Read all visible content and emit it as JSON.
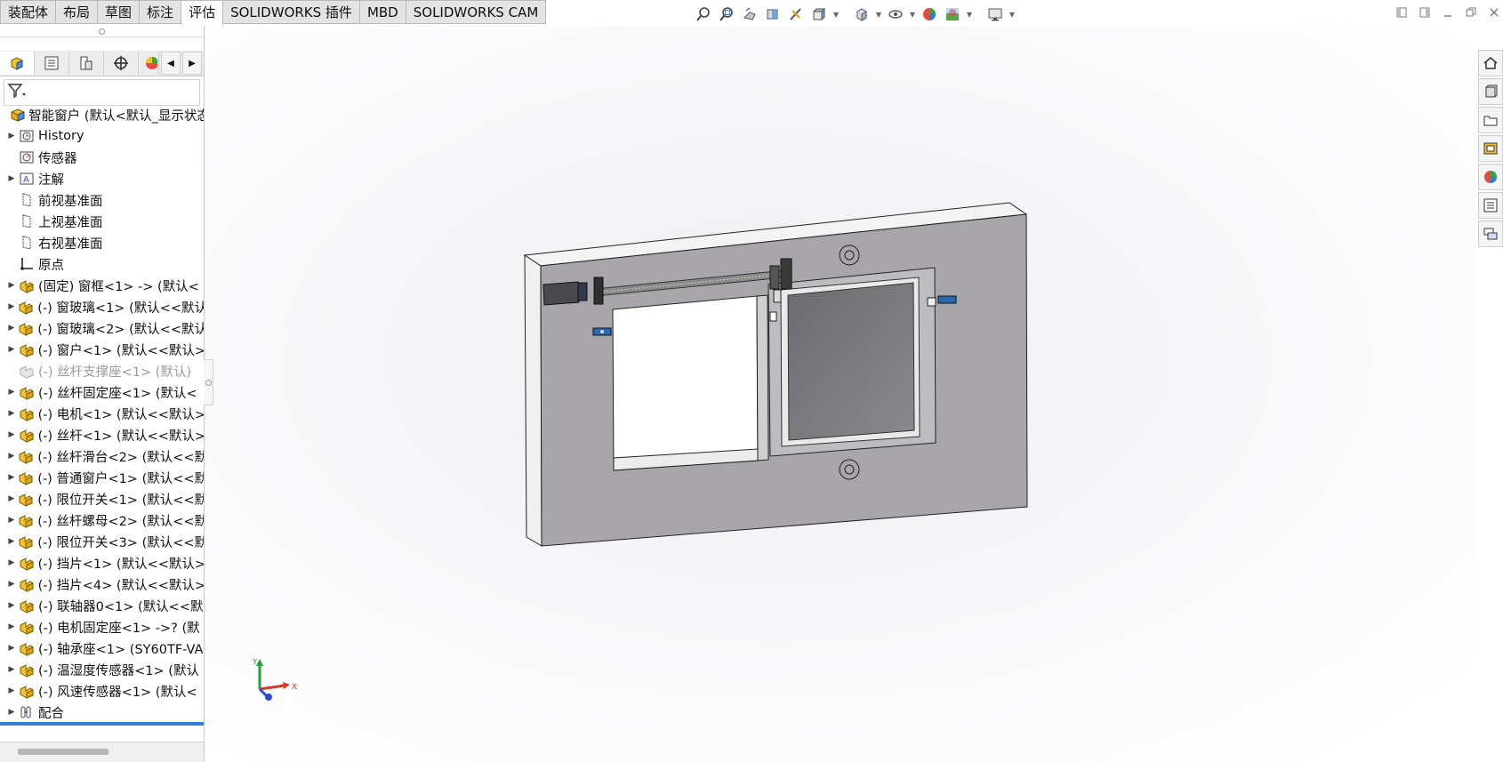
{
  "tabs": [
    {
      "label": "装配体",
      "active": false
    },
    {
      "label": "布局",
      "active": false
    },
    {
      "label": "草图",
      "active": false
    },
    {
      "label": "标注",
      "active": false
    },
    {
      "label": "评估",
      "active": true
    },
    {
      "label": "SOLIDWORKS 插件",
      "active": false
    },
    {
      "label": "MBD",
      "active": false
    },
    {
      "label": "SOLIDWORKS CAM",
      "active": false
    }
  ],
  "tree": {
    "root": "智能窗户 (默认<默认_显示状态",
    "items": [
      {
        "label": "History",
        "icon": "history-icon",
        "expand": true,
        "dim": false
      },
      {
        "label": "传感器",
        "icon": "sensor-icon",
        "expand": false,
        "dim": false
      },
      {
        "label": "注解",
        "icon": "annotation-icon",
        "expand": true,
        "dim": false
      },
      {
        "label": "前视基准面",
        "icon": "plane-icon",
        "expand": false,
        "dim": false
      },
      {
        "label": "上视基准面",
        "icon": "plane-icon",
        "expand": false,
        "dim": false
      },
      {
        "label": "右视基准面",
        "icon": "plane-icon",
        "expand": false,
        "dim": false
      },
      {
        "label": "原点",
        "icon": "origin-icon",
        "expand": false,
        "dim": false
      },
      {
        "label": "(固定) 窗框<1> -> (默认<",
        "icon": "part-icon",
        "expand": true,
        "dim": false
      },
      {
        "label": "(-) 窗玻璃<1> (默认<<默认",
        "icon": "part-icon",
        "expand": true,
        "dim": false
      },
      {
        "label": "(-) 窗玻璃<2> (默认<<默认",
        "icon": "part-icon",
        "expand": true,
        "dim": false
      },
      {
        "label": "(-) 窗户<1> (默认<<默认>",
        "icon": "part-icon",
        "expand": true,
        "dim": false
      },
      {
        "label": "(-) 丝杆支撑座<1> (默认)",
        "icon": "part-icon",
        "expand": false,
        "dim": true
      },
      {
        "label": "(-) 丝杆固定座<1> (默认<",
        "icon": "part-icon",
        "expand": true,
        "dim": false
      },
      {
        "label": "(-) 电机<1> (默认<<默认>",
        "icon": "part-icon",
        "expand": true,
        "dim": false
      },
      {
        "label": "(-) 丝杆<1> (默认<<默认>",
        "icon": "part-icon",
        "expand": true,
        "dim": false
      },
      {
        "label": "(-) 丝杆滑台<2> (默认<<默",
        "icon": "part-icon",
        "expand": true,
        "dim": false
      },
      {
        "label": "(-) 普通窗户<1> (默认<<默",
        "icon": "part-icon",
        "expand": true,
        "dim": false
      },
      {
        "label": "(-) 限位开关<1> (默认<<默",
        "icon": "part-icon",
        "expand": true,
        "dim": false
      },
      {
        "label": "(-) 丝杆螺母<2> (默认<<默",
        "icon": "part-icon",
        "expand": true,
        "dim": false
      },
      {
        "label": "(-) 限位开关<3> (默认<<默",
        "icon": "part-icon",
        "expand": true,
        "dim": false
      },
      {
        "label": "(-) 挡片<1> (默认<<默认>",
        "icon": "part-icon",
        "expand": true,
        "dim": false
      },
      {
        "label": "(-) 挡片<4> (默认<<默认>",
        "icon": "part-icon",
        "expand": true,
        "dim": false
      },
      {
        "label": "(-) 联轴器0<1> (默认<<默",
        "icon": "part-icon",
        "expand": true,
        "dim": false
      },
      {
        "label": "(-) 电机固定座<1> ->? (默",
        "icon": "part-icon",
        "expand": true,
        "dim": false
      },
      {
        "label": "(-) 轴承座<1> (SY60TF-VA",
        "icon": "part-icon",
        "expand": true,
        "dim": false
      },
      {
        "label": "(-) 温湿度传感器<1> (默认",
        "icon": "part-icon",
        "expand": true,
        "dim": false
      },
      {
        "label": "(-) 风速传感器<1> (默认<",
        "icon": "part-icon",
        "expand": true,
        "dim": false
      },
      {
        "label": "配合",
        "icon": "mates-icon",
        "expand": true,
        "dim": false
      }
    ]
  },
  "triad": {
    "x": "X",
    "y": "Y"
  },
  "colors": {
    "accent": "#2f7fd6",
    "model_face": "#a8a6aa",
    "model_top": "#f2f2f2"
  }
}
